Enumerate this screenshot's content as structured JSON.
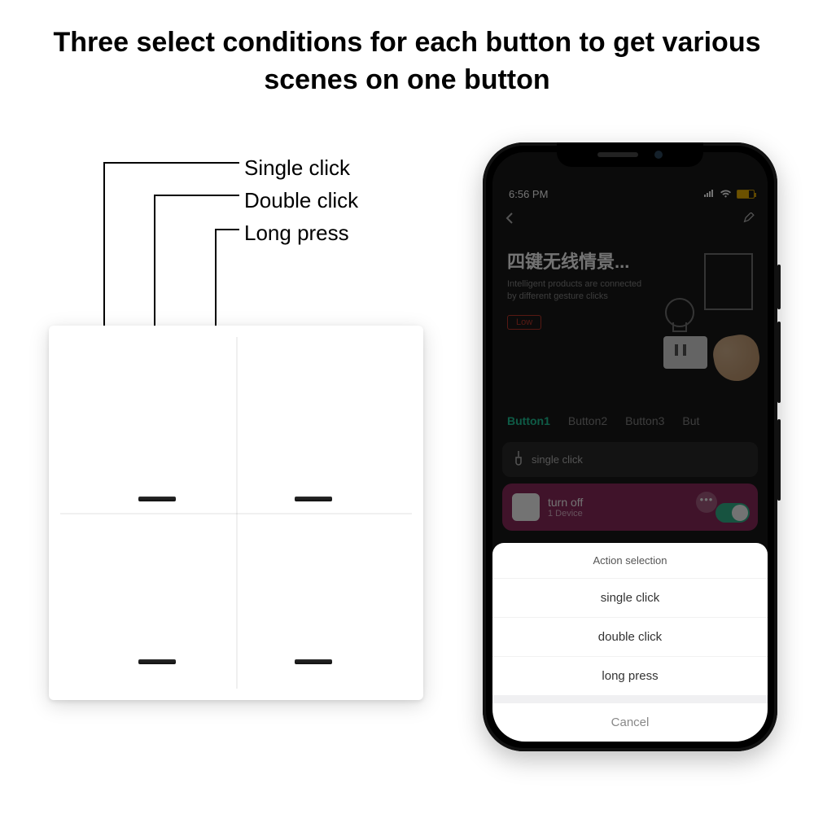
{
  "headline": "Three select conditions for each button to get various scenes on one button",
  "labels": {
    "single": "Single click",
    "double": "Double click",
    "long": "Long press"
  },
  "status": {
    "time": "6:56 PM"
  },
  "app": {
    "hero_title": "四键无线情景...",
    "hero_sub": "Intelligent products are connected by different gesture clicks",
    "low": "Low",
    "tabs": [
      "Button1",
      "Button2",
      "Button3",
      "But"
    ],
    "section_label": "single click",
    "scene_title": "turn off",
    "scene_sub": "1 Device"
  },
  "sheet": {
    "title": "Action selection",
    "opt1": "single click",
    "opt2": "double click",
    "opt3": "long press",
    "cancel": "Cancel"
  }
}
